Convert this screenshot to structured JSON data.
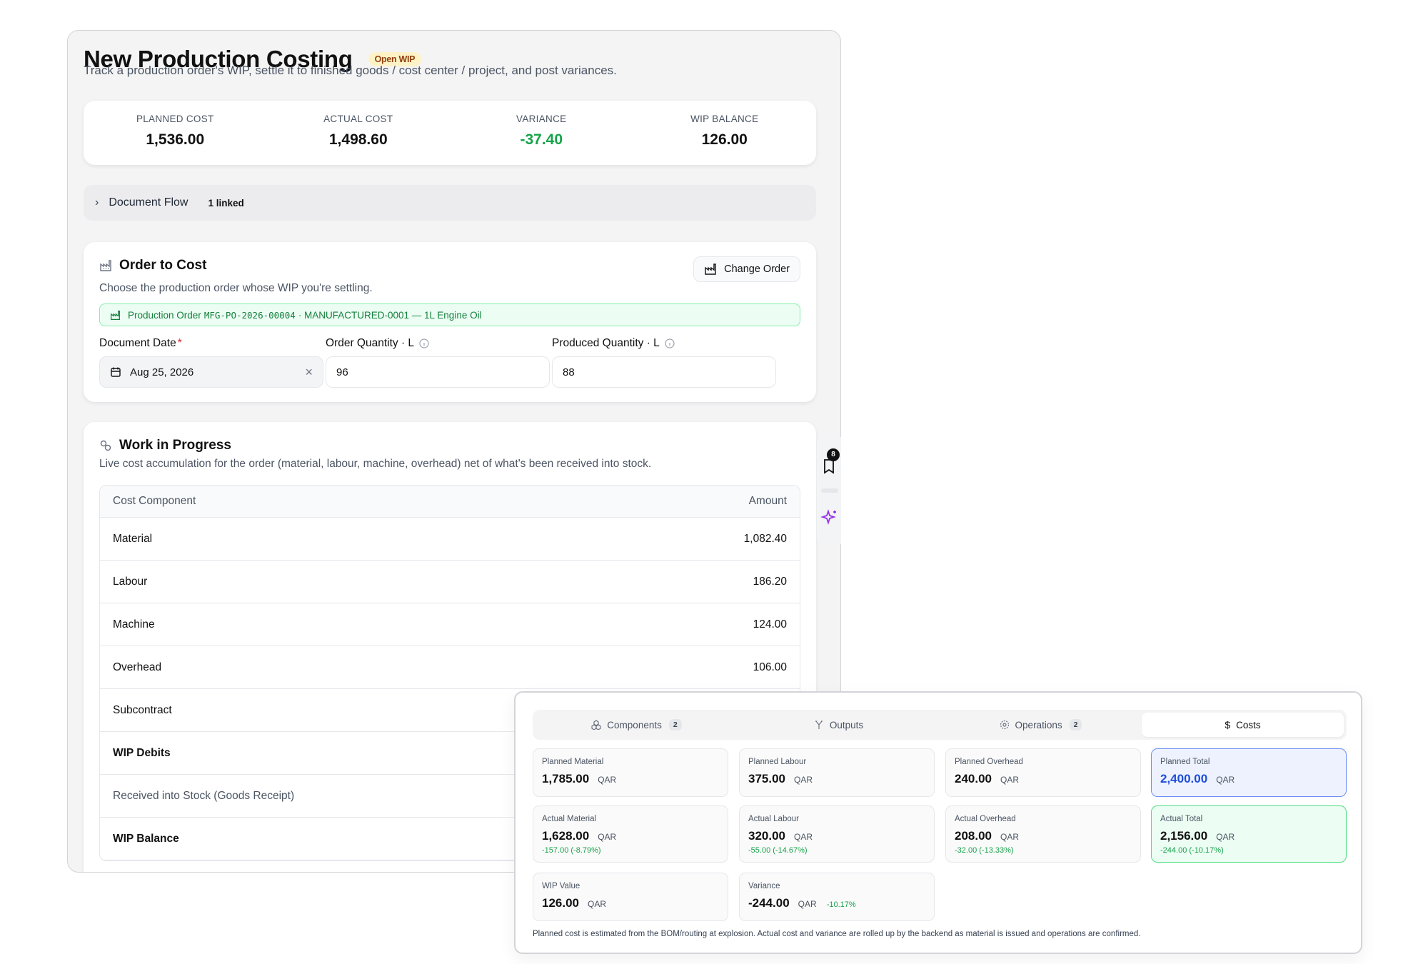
{
  "header": {
    "title": "New Production Costing",
    "status_badge": "Open WIP",
    "subtitle": "Track a production order's WIP, settle it to finished goods / cost center / project, and post variances."
  },
  "summary": [
    {
      "label": "PLANNED COST",
      "value": "1,536.00"
    },
    {
      "label": "ACTUAL COST",
      "value": "1,498.60"
    },
    {
      "label": "VARIANCE",
      "value": "-37.40"
    },
    {
      "label": "WIP BALANCE",
      "value": "126.00"
    }
  ],
  "document_flow": {
    "label": "Document Flow",
    "count": "1 linked"
  },
  "order_to_cost": {
    "title": "Order to Cost",
    "description": "Choose the production order whose WIP you're settling.",
    "change_button": "Change Order",
    "chip_prefix": "Production Order",
    "chip_order_no": "MFG-PO-2026-00004",
    "chip_suffix": "· MANUFACTURED-0001 — 1L Engine Oil",
    "document_date": {
      "label": "Document Date",
      "required_mark": "*",
      "value": "Aug 25, 2026"
    },
    "order_quantity": {
      "label": "Order Quantity · L",
      "value": "96"
    },
    "produced_quantity": {
      "label": "Produced Quantity · L",
      "value": "88"
    }
  },
  "wip": {
    "title": "Work in Progress",
    "description": "Live cost accumulation for the order (material, labour, machine, overhead) net of what's been received into stock.",
    "columns": [
      "Cost Component",
      "Amount"
    ],
    "rows": [
      {
        "label": "Material",
        "amount": "1,082.40"
      },
      {
        "label": "Labour",
        "amount": "186.20"
      },
      {
        "label": "Machine",
        "amount": "124.00"
      },
      {
        "label": "Overhead",
        "amount": "106.00"
      },
      {
        "label": "Subcontract",
        "amount": ""
      },
      {
        "label": "WIP Debits",
        "amount": ""
      },
      {
        "label": "Received into Stock (Goods Receipt)",
        "amount": ""
      },
      {
        "label": "WIP Balance",
        "amount": ""
      }
    ]
  },
  "side_rail": {
    "bookmark_count": "8"
  },
  "costs_panel": {
    "tabs": [
      {
        "label": "Components",
        "count": "2",
        "icon": "boxes-icon"
      },
      {
        "label": "Outputs",
        "count": "",
        "icon": "fork-icon"
      },
      {
        "label": "Operations",
        "count": "2",
        "icon": "gear-icon"
      },
      {
        "label": "Costs",
        "count": "",
        "icon": "dollar-icon"
      }
    ],
    "active_tab": "Costs",
    "currency": "QAR",
    "metrics": {
      "planned_material": {
        "label": "Planned Material",
        "value": "1,785.00"
      },
      "planned_labour": {
        "label": "Planned Labour",
        "value": "375.00"
      },
      "planned_overhead": {
        "label": "Planned Overhead",
        "value": "240.00"
      },
      "planned_total": {
        "label": "Planned Total",
        "value": "2,400.00"
      },
      "actual_material": {
        "label": "Actual Material",
        "value": "1,628.00",
        "delta": "-157.00 (-8.79%)"
      },
      "actual_labour": {
        "label": "Actual Labour",
        "value": "320.00",
        "delta": "-55.00 (-14.67%)"
      },
      "actual_overhead": {
        "label": "Actual Overhead",
        "value": "208.00",
        "delta": "-32.00 (-13.33%)"
      },
      "actual_total": {
        "label": "Actual Total",
        "value": "2,156.00",
        "delta": "-244.00 (-10.17%)"
      },
      "wip_value": {
        "label": "WIP Value",
        "value": "126.00"
      },
      "variance": {
        "label": "Variance",
        "value": "-244.00",
        "delta": "-10.17%"
      }
    },
    "footnote": "Planned cost is estimated from the BOM/routing at explosion. Actual cost and variance are rolled up by the backend as material is issued and operations are confirmed."
  },
  "colors": {
    "accent_green": "#16a34a",
    "accent_blue": "#1d4ed8",
    "badge_yellow": "#fef3c7"
  }
}
